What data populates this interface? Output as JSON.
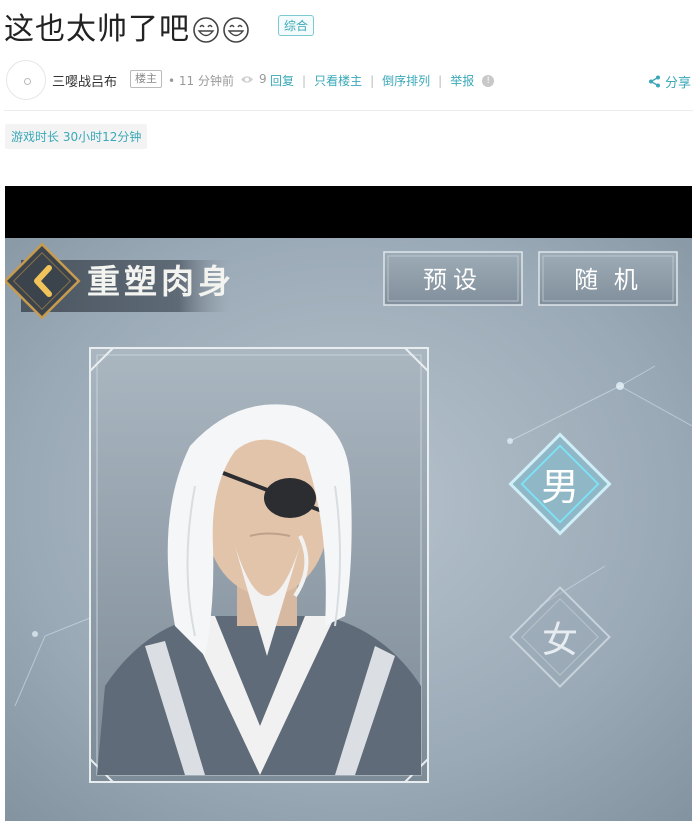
{
  "post": {
    "title": "这也太帅了吧",
    "tag": "综合",
    "emoji": "grinning-face-emoji"
  },
  "meta": {
    "author": "三嘤战吕布",
    "owner_badge": "楼主",
    "time": "• 11 分钟前",
    "views": "9",
    "reply": "回复",
    "only_owner": "只看楼主",
    "reverse": "倒序排列",
    "report": "举报",
    "share": "分享"
  },
  "playtime": "游戏时长 30小时12分钟",
  "game": {
    "screen_title": "重塑肉身",
    "preset_button": "预设",
    "random_button": "随 机",
    "male_label": "男",
    "female_label": "女"
  },
  "colors": {
    "accent": "#3aa8b8",
    "text": "#333333",
    "muted": "#999999"
  }
}
